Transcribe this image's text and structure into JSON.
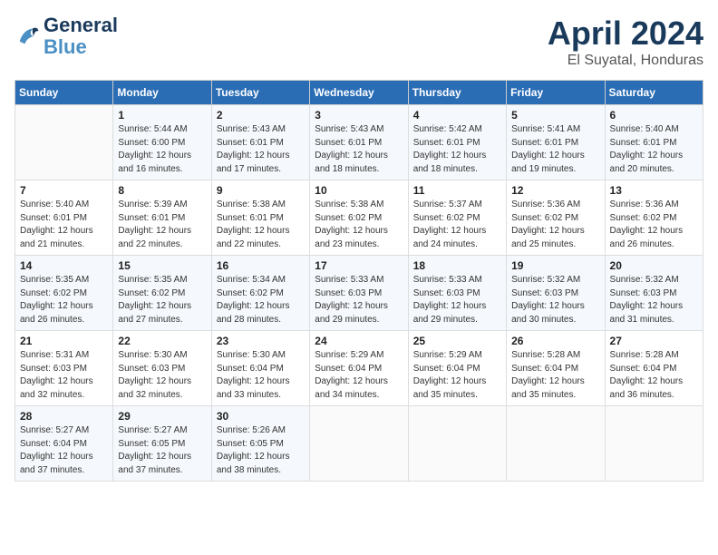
{
  "header": {
    "logo_line1": "General",
    "logo_line2": "Blue",
    "month": "April 2024",
    "location": "El Suyatal, Honduras"
  },
  "days_of_week": [
    "Sunday",
    "Monday",
    "Tuesday",
    "Wednesday",
    "Thursday",
    "Friday",
    "Saturday"
  ],
  "weeks": [
    [
      {
        "day": "",
        "sunrise": "",
        "sunset": "",
        "daylight": ""
      },
      {
        "day": "1",
        "sunrise": "5:44 AM",
        "sunset": "6:00 PM",
        "daylight": "12 hours and 16 minutes."
      },
      {
        "day": "2",
        "sunrise": "5:43 AM",
        "sunset": "6:01 PM",
        "daylight": "12 hours and 17 minutes."
      },
      {
        "day": "3",
        "sunrise": "5:43 AM",
        "sunset": "6:01 PM",
        "daylight": "12 hours and 18 minutes."
      },
      {
        "day": "4",
        "sunrise": "5:42 AM",
        "sunset": "6:01 PM",
        "daylight": "12 hours and 18 minutes."
      },
      {
        "day": "5",
        "sunrise": "5:41 AM",
        "sunset": "6:01 PM",
        "daylight": "12 hours and 19 minutes."
      },
      {
        "day": "6",
        "sunrise": "5:40 AM",
        "sunset": "6:01 PM",
        "daylight": "12 hours and 20 minutes."
      }
    ],
    [
      {
        "day": "7",
        "sunrise": "5:40 AM",
        "sunset": "6:01 PM",
        "daylight": "12 hours and 21 minutes."
      },
      {
        "day": "8",
        "sunrise": "5:39 AM",
        "sunset": "6:01 PM",
        "daylight": "12 hours and 22 minutes."
      },
      {
        "day": "9",
        "sunrise": "5:38 AM",
        "sunset": "6:01 PM",
        "daylight": "12 hours and 22 minutes."
      },
      {
        "day": "10",
        "sunrise": "5:38 AM",
        "sunset": "6:02 PM",
        "daylight": "12 hours and 23 minutes."
      },
      {
        "day": "11",
        "sunrise": "5:37 AM",
        "sunset": "6:02 PM",
        "daylight": "12 hours and 24 minutes."
      },
      {
        "day": "12",
        "sunrise": "5:36 AM",
        "sunset": "6:02 PM",
        "daylight": "12 hours and 25 minutes."
      },
      {
        "day": "13",
        "sunrise": "5:36 AM",
        "sunset": "6:02 PM",
        "daylight": "12 hours and 26 minutes."
      }
    ],
    [
      {
        "day": "14",
        "sunrise": "5:35 AM",
        "sunset": "6:02 PM",
        "daylight": "12 hours and 26 minutes."
      },
      {
        "day": "15",
        "sunrise": "5:35 AM",
        "sunset": "6:02 PM",
        "daylight": "12 hours and 27 minutes."
      },
      {
        "day": "16",
        "sunrise": "5:34 AM",
        "sunset": "6:02 PM",
        "daylight": "12 hours and 28 minutes."
      },
      {
        "day": "17",
        "sunrise": "5:33 AM",
        "sunset": "6:03 PM",
        "daylight": "12 hours and 29 minutes."
      },
      {
        "day": "18",
        "sunrise": "5:33 AM",
        "sunset": "6:03 PM",
        "daylight": "12 hours and 29 minutes."
      },
      {
        "day": "19",
        "sunrise": "5:32 AM",
        "sunset": "6:03 PM",
        "daylight": "12 hours and 30 minutes."
      },
      {
        "day": "20",
        "sunrise": "5:32 AM",
        "sunset": "6:03 PM",
        "daylight": "12 hours and 31 minutes."
      }
    ],
    [
      {
        "day": "21",
        "sunrise": "5:31 AM",
        "sunset": "6:03 PM",
        "daylight": "12 hours and 32 minutes."
      },
      {
        "day": "22",
        "sunrise": "5:30 AM",
        "sunset": "6:03 PM",
        "daylight": "12 hours and 32 minutes."
      },
      {
        "day": "23",
        "sunrise": "5:30 AM",
        "sunset": "6:04 PM",
        "daylight": "12 hours and 33 minutes."
      },
      {
        "day": "24",
        "sunrise": "5:29 AM",
        "sunset": "6:04 PM",
        "daylight": "12 hours and 34 minutes."
      },
      {
        "day": "25",
        "sunrise": "5:29 AM",
        "sunset": "6:04 PM",
        "daylight": "12 hours and 35 minutes."
      },
      {
        "day": "26",
        "sunrise": "5:28 AM",
        "sunset": "6:04 PM",
        "daylight": "12 hours and 35 minutes."
      },
      {
        "day": "27",
        "sunrise": "5:28 AM",
        "sunset": "6:04 PM",
        "daylight": "12 hours and 36 minutes."
      }
    ],
    [
      {
        "day": "28",
        "sunrise": "5:27 AM",
        "sunset": "6:04 PM",
        "daylight": "12 hours and 37 minutes."
      },
      {
        "day": "29",
        "sunrise": "5:27 AM",
        "sunset": "6:05 PM",
        "daylight": "12 hours and 37 minutes."
      },
      {
        "day": "30",
        "sunrise": "5:26 AM",
        "sunset": "6:05 PM",
        "daylight": "12 hours and 38 minutes."
      },
      {
        "day": "",
        "sunrise": "",
        "sunset": "",
        "daylight": ""
      },
      {
        "day": "",
        "sunrise": "",
        "sunset": "",
        "daylight": ""
      },
      {
        "day": "",
        "sunrise": "",
        "sunset": "",
        "daylight": ""
      },
      {
        "day": "",
        "sunrise": "",
        "sunset": "",
        "daylight": ""
      }
    ]
  ]
}
